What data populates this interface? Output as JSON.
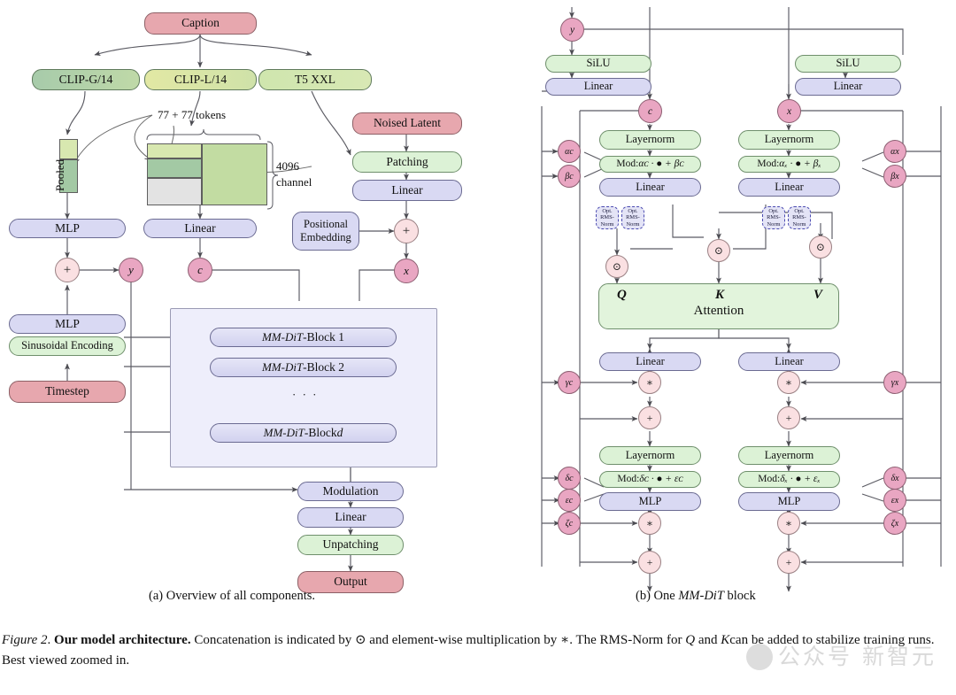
{
  "figure": {
    "subcaption_a": "(a) Overview of all components.",
    "subcaption_b_pre": "(b) One ",
    "subcaption_b_it": "MM-DiT",
    "subcaption_b_post": " block",
    "caption_number": "Figure 2",
    "caption_title": "Our model architecture.",
    "caption_body_1": " Concatenation is indicated by ⊙ and element-wise multiplication by ∗. The RMS-Norm for ",
    "caption_q": "Q",
    "caption_and": " and ",
    "caption_k": "K",
    "caption_body_2": "can be added to stabilize training runs. Best viewed zoomed in.",
    "watermark": "公众号 新智元"
  },
  "panel_a": {
    "caption_box": "Caption",
    "encoders": [
      {
        "label": "CLIP-G/14"
      },
      {
        "label": "CLIP-L/14"
      },
      {
        "label": "T5 XXL"
      }
    ],
    "annotations": {
      "tokens": "77 + 77 tokens",
      "channel_line1": "4096",
      "channel_line2": "channel",
      "pooled": "Pooled"
    },
    "left_stack": {
      "mlp_top": "MLP",
      "mlp_bottom": "MLP",
      "sinusoidal": "Sinusoidal Encoding",
      "timestep": "Timestep"
    },
    "mid_stack": {
      "linear": "Linear"
    },
    "right_stack": {
      "noised_latent": "Noised Latent",
      "patching": "Patching",
      "linear": "Linear",
      "positional_embedding_l1": "Positional",
      "positional_embedding_l2": "Embedding"
    },
    "vars": {
      "y": "y",
      "c": "c",
      "x": "x"
    },
    "ops": {
      "plus": "+"
    },
    "blocks": [
      {
        "prefix": "MM-DiT",
        "suffix": "-Block 1"
      },
      {
        "prefix": "MM-DiT",
        "suffix": "-Block 2"
      },
      {
        "ellipsis": "· · ·"
      },
      {
        "prefix": "MM-DiT",
        "suffix": "-Block ",
        "italic_tail": "d"
      }
    ],
    "tail": {
      "modulation": "Modulation",
      "linear": "Linear",
      "unpatching": "Unpatching",
      "output": "Output"
    }
  },
  "panel_b": {
    "top": {
      "y": "y",
      "c": "c",
      "x": "x"
    },
    "silu": "SiLU",
    "linear": "Linear",
    "layernorm": "Layernorm",
    "mlp": "MLP",
    "rmsnorm_l1": "Opt.",
    "rmsnorm_l2": "RMS-",
    "rmsnorm_l3": "Norm",
    "mod_c_1": "Mod: ",
    "mod_c_expr1": "αᴄ · ● + βᴄ",
    "mod_x_expr1": "αₓ · ● + βₓ",
    "mod_c_expr2": "δᴄ · ● + εᴄ",
    "mod_x_expr2": "δₓ · ● + εₓ",
    "attention": {
      "q": "Q",
      "k": "K",
      "v": "V",
      "label": "Attention"
    },
    "params_left": [
      "αc",
      "βc",
      "γc",
      "δc",
      "εc",
      "ζc"
    ],
    "params_right": [
      "αx",
      "βx",
      "γx",
      "δx",
      "εx",
      "ζx"
    ],
    "ops": {
      "concat": "⊙",
      "mult": "∗",
      "add": "+"
    }
  },
  "colors": {
    "pink": "#e7a7ae",
    "green": "#dcf2d6",
    "blue": "#d9d9f3",
    "circle_pink": "#e9a6c2",
    "circle_pale": "#fae0e2",
    "token_dark_green": "#a3c9a4",
    "token_light_green": "#d8e8b0",
    "token_mid_green": "#c2dca2",
    "token_gray": "#e3e3e3",
    "block_bg": "#eeeefb",
    "line": "#5b5b63"
  }
}
